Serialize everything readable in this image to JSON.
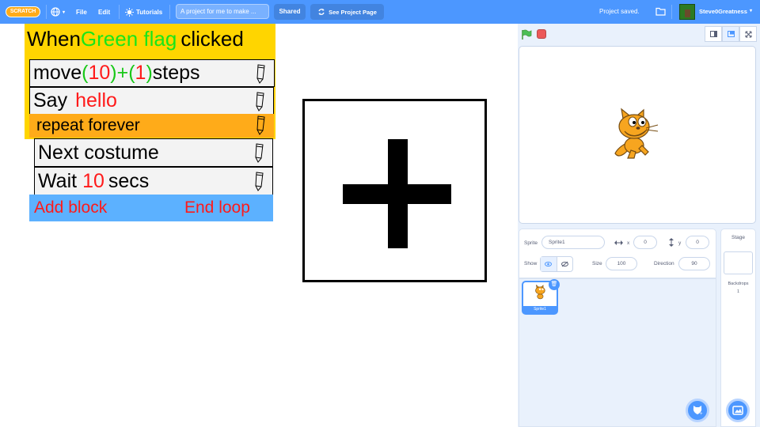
{
  "menubar": {
    "logo": "SCRATCH",
    "file": "File",
    "edit": "Edit",
    "tutorials": "Tutorials",
    "project_title": "A project for me to make ...",
    "shared": "Shared",
    "see_project_page": "See Project Page",
    "status": "Project saved.",
    "username": "Steve0Greatness"
  },
  "workspace": {
    "hat": {
      "when": "When",
      "flag": "Green flag",
      "clicked": "clicked"
    },
    "move": {
      "word": "move",
      "p1": "(",
      "n1": "10",
      "p2": ")+(",
      "n2": "1",
      "p3": ")",
      "steps": "steps"
    },
    "say": {
      "word": "Say",
      "value": "hello"
    },
    "repeat": "repeat forever",
    "next_costume": "Next costume",
    "wait": {
      "word": "Wait",
      "value": "10",
      "unit": "secs"
    },
    "add_block": "Add block",
    "end_loop": "End loop"
  },
  "sprite_info": {
    "sprite_label": "Sprite",
    "sprite_name": "Sprite1",
    "x_label": "x",
    "x_value": "0",
    "y_label": "y",
    "y_value": "0",
    "show_label": "Show",
    "size_label": "Size",
    "size_value": "100",
    "direction_label": "Direction",
    "direction_value": "90"
  },
  "sprite_list": [
    {
      "name": "Sprite1"
    }
  ],
  "stage_panel": {
    "title": "Stage",
    "backdrops_label": "Backdrops",
    "backdrops_count": "1"
  },
  "colors": {
    "menubar": "#4c97ff",
    "hat": "#ffd500",
    "repeat": "#ffab19",
    "cblock_bottom": "#5cb1ff"
  }
}
